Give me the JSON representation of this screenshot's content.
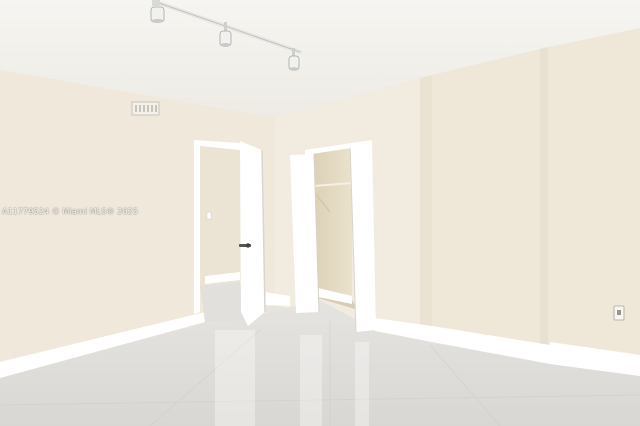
{
  "photo": {
    "watermark": "A11779524 © Miami MLS® 2025",
    "colors": {
      "ceiling": "#f3f1ec",
      "wall_left": "#f0e9db",
      "wall_center": "#f2ece0",
      "wall_right": "#efe8d9",
      "floor": "#dedcd8",
      "trim": "#ffffff",
      "door": "#ffffff",
      "closet_interior": "#e6dcc3",
      "hallway": "#ebe3d3",
      "track_light": "#e7e7e5"
    },
    "objects": [
      "track-light-icon",
      "ceiling-vent",
      "open-bedroom-door",
      "hallway",
      "open-closet-doors",
      "closet-rod",
      "electrical-outlet",
      "tile-floor",
      "baseboards"
    ]
  }
}
